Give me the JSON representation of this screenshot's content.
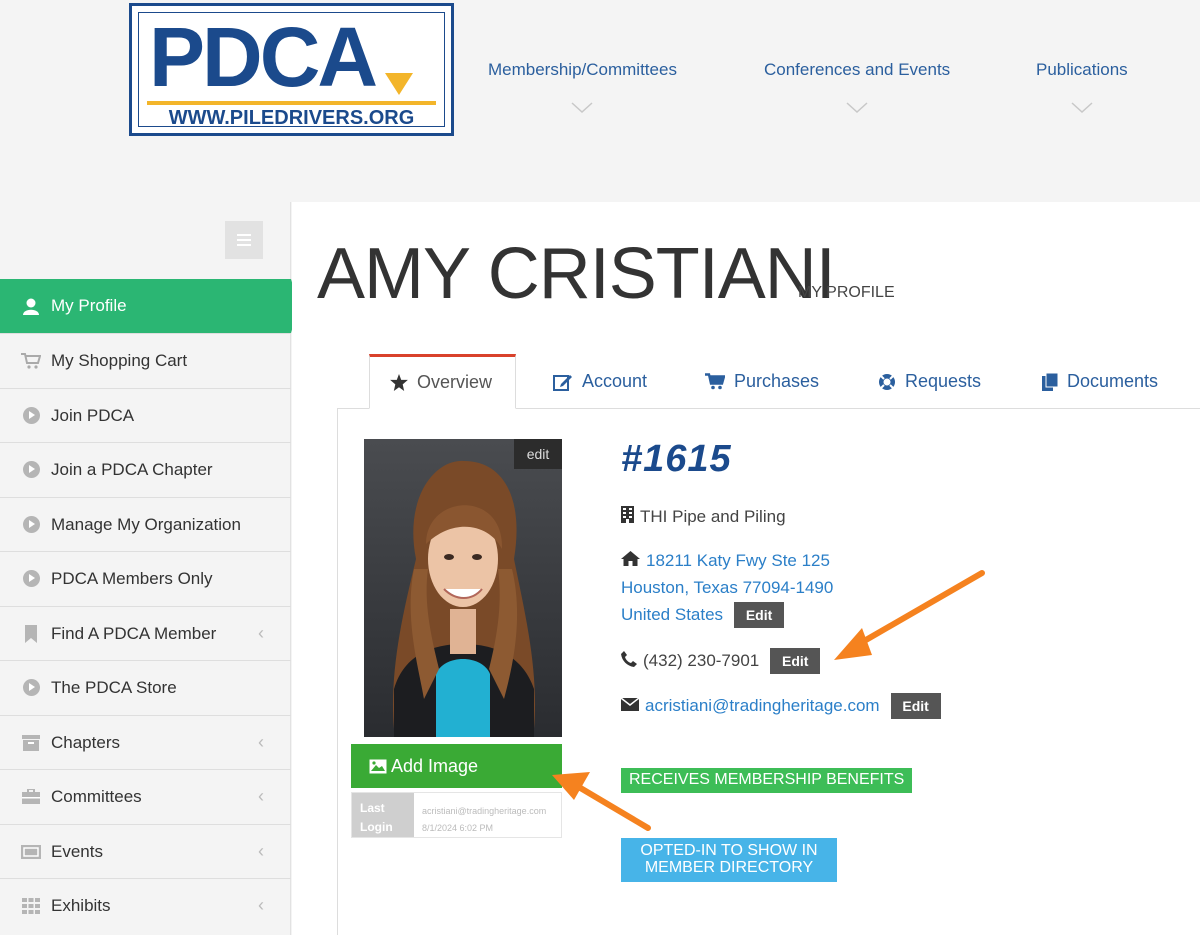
{
  "header": {
    "logo": {
      "main_text": "PDCA",
      "url_text": "WWW.PILEDRIVERS.ORG",
      "primary_color": "#1b4a8c",
      "accent_color": "#f3b52a"
    },
    "nav": [
      {
        "label": "Membership/Committees"
      },
      {
        "label": "Conferences and Events"
      },
      {
        "label": "Publications"
      }
    ]
  },
  "sidebar": {
    "toggle_icon": "menu-icon",
    "items": [
      {
        "label": "My Profile",
        "icon": "user-icon",
        "active": true
      },
      {
        "label": "My Shopping Cart",
        "icon": "cart-icon"
      },
      {
        "label": "Join PDCA",
        "icon": "arrow-circle-icon"
      },
      {
        "label": "Join a PDCA Chapter",
        "icon": "arrow-circle-icon"
      },
      {
        "label": "Manage My Organization",
        "icon": "arrow-circle-icon"
      },
      {
        "label": "PDCA Members Only",
        "icon": "arrow-circle-icon"
      },
      {
        "label": "Find A PDCA Member",
        "icon": "bookmark-icon",
        "caret": "‹"
      },
      {
        "label": "The PDCA Store",
        "icon": "arrow-circle-icon"
      },
      {
        "label": "Chapters",
        "icon": "archive-icon",
        "caret": "‹"
      },
      {
        "label": "Committees",
        "icon": "briefcase-icon",
        "caret": "‹"
      },
      {
        "label": "Events",
        "icon": "ticket-icon",
        "caret": "‹"
      },
      {
        "label": "Exhibits",
        "icon": "grid-icon",
        "caret": "‹"
      }
    ],
    "active_color": "#2bb673"
  },
  "main": {
    "title": "AMY CRISTIANI",
    "subtitle": "MY PROFILE",
    "tabs": [
      {
        "label": "Overview",
        "icon": "star-icon",
        "active": true
      },
      {
        "label": "Account",
        "icon": "edit-icon"
      },
      {
        "label": "Purchases",
        "icon": "cart-icon"
      },
      {
        "label": "Requests",
        "icon": "lifebuoy-icon"
      },
      {
        "label": "Documents",
        "icon": "files-icon"
      }
    ],
    "photo": {
      "edit_label": "edit"
    },
    "add_image_label": "Add Image",
    "last_login": {
      "label_1": "Last",
      "label_2": "Login",
      "email": "acristiani@tradingheritage.com",
      "datetime": "8/1/2024 6:02 PM"
    },
    "member_id": "#1615",
    "company": "THI Pipe and Piling",
    "address": {
      "line1": "18211 Katy Fwy Ste 125",
      "line2": "Houston, Texas 77094-1490",
      "line3": "United States"
    },
    "phone": "(432) 230-7901",
    "email": "acristiani@tradingheritage.com",
    "edit_label": "Edit",
    "badges": {
      "benefits": "RECEIVES MEMBERSHIP BENEFITS",
      "directory_1": "OPTED-IN TO SHOW IN",
      "directory_2": "MEMBER DIRECTORY"
    },
    "annotation_color": "#f5821f"
  }
}
